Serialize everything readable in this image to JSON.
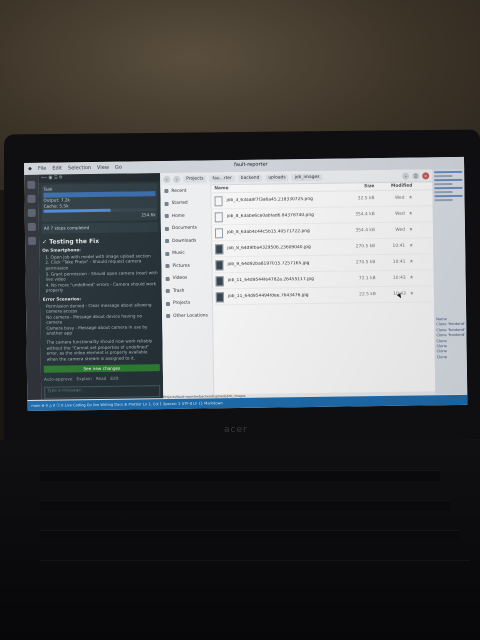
{
  "window_title": "fault-reporter",
  "menu": [
    "File",
    "Edit",
    "Selection",
    "View",
    "Go"
  ],
  "editor": {
    "task_label": "Task",
    "status_rows": [
      {
        "label": "Output",
        "value": "7.2k"
      },
      {
        "label": "Cache",
        "value": "5.5k"
      }
    ],
    "progress_fraction": 0.6,
    "progress_value": "254.6k",
    "step_label": "All 7 steps completed",
    "section_title": "Testing the Fix",
    "on_smartphone": "On Smartphone:",
    "steps": [
      "1. Open job with model with image upload section",
      "2. Click \"Take Photo\" - Should request camera permission",
      "3. Grant permission - Should open camera (rear) with live video",
      "4. No more \"undefined\" errors - Camera should work properly"
    ],
    "error_title": "Error Scenarios:",
    "errors": [
      "Permission denied - Clear message about allowing camera access",
      "No camera - Message about device having no camera",
      "Camera busy - Message about camera in use by another app"
    ],
    "summary": "The camera functionality should now work reliably without the \"Cannot set properties of undefined\" error, as the video element is properly available when the camera stream is assigned to it.",
    "see_changes": "See new changes",
    "controls": [
      "Auto-approve",
      "Explain",
      "Read",
      "Edit"
    ],
    "input_placeholder": "Type a message..."
  },
  "file_manager": {
    "breadcrumb": [
      "Projects",
      "fau...rter",
      "backend",
      "uploads",
      "job_images"
    ],
    "sidebar": [
      "Recent",
      "Starred",
      "Home",
      "Documents",
      "Downloads",
      "Music",
      "Pictures",
      "Videos",
      "Trash",
      "Projects",
      "Other Locations"
    ],
    "columns": {
      "name": "Name",
      "size": "Size",
      "modified": "Modified"
    },
    "files": [
      {
        "name": "job_3_63aa8f7f3a6a45.218330725.png",
        "size": "32.5 kB",
        "modified": "Wed",
        "dark": false
      },
      {
        "name": "job_8_63abe6ce0abfad6.84378740.png",
        "size": "354.4 kB",
        "modified": "Wed",
        "dark": false
      },
      {
        "name": "job_8_63ab4c44c5b15.40571722.png",
        "size": "354.4 kB",
        "modified": "Wed",
        "dark": false
      },
      {
        "name": "job_8_64d9fba4329506.23609040.jpg",
        "size": "270.5 kB",
        "modified": "10:41",
        "dark": true
      },
      {
        "name": "job_9_64d92ba8197015.7257165.jpg",
        "size": "270.5 kB",
        "modified": "10:41",
        "dark": true
      },
      {
        "name": "job_11_64d9544fe4782a.26455117.jpg",
        "size": "72.1 kB",
        "modified": "10:43",
        "dark": true
      },
      {
        "name": "job_11_64d954494fdee.7643476.jpg",
        "size": "22.5 kB",
        "modified": "10:43",
        "dark": true
      }
    ]
  },
  "notifications": [
    "Name",
    "Clone 'frontend'",
    "Clone 'frontend'",
    "Clone 'frontend'",
    "Clone",
    "Clone",
    "Clone",
    "Clone"
  ],
  "path_line": "Projects/fault-reporter/backend/uploads/job_images",
  "status_bar": "main  ⊗ 0 △ 0  ⓘ 0  Live Coding  Go live  Writing Docs  ⊕ Prettier   Ln 1, Col 1  Spaces: 2  UTF-8  LF  {} Markdown"
}
